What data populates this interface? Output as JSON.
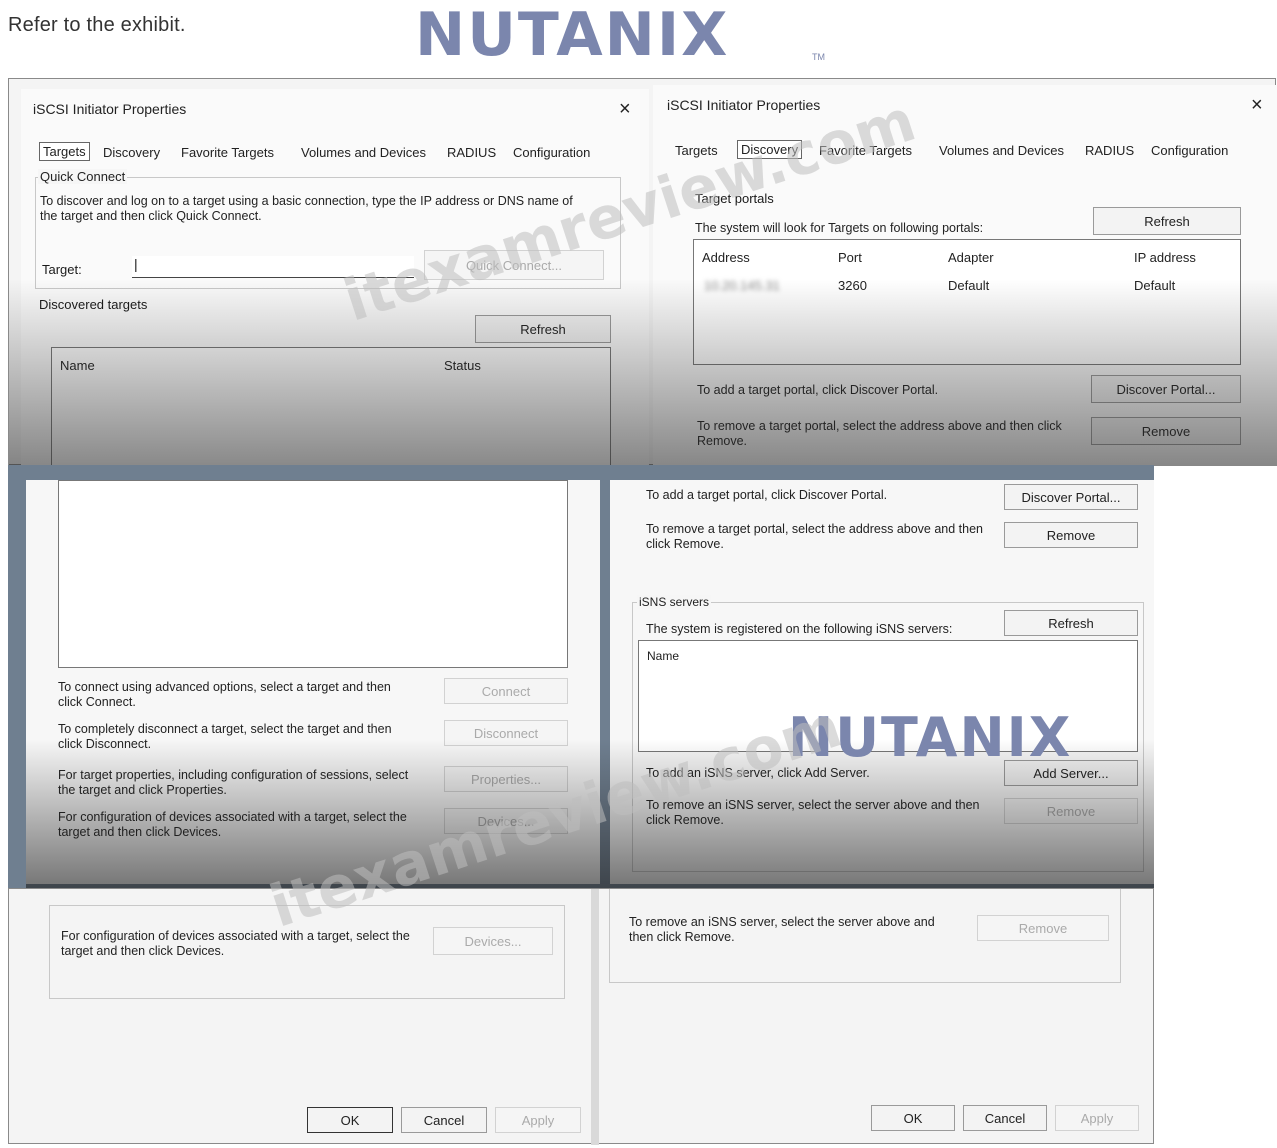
{
  "header": {
    "prompt": "Refer to the exhibit.",
    "logo_text": "NUTANIX",
    "logo_tm": "TM"
  },
  "watermark": {
    "text1": "itexamreview.com",
    "text2": "itexamreview.com"
  },
  "targets_window": {
    "title": "iSCSI Initiator Properties",
    "close_glyph": "×",
    "tabs": [
      "Targets",
      "Discovery",
      "Favorite Targets",
      "Volumes and Devices",
      "RADIUS",
      "Configuration"
    ],
    "quick_connect": {
      "label": "Quick Connect",
      "description": "To discover and log on to a target using a basic connection, type the IP address or DNS name of the target and then click Quick Connect.",
      "target_label": "Target:",
      "target_value": "|",
      "quick_connect_button": "Quick Connect..."
    },
    "discovered": {
      "label": "Discovered targets",
      "refresh_button": "Refresh",
      "columns": [
        "Name",
        "Status"
      ]
    },
    "actions": [
      {
        "text": "To connect using advanced options, select a target and then click Connect.",
        "button": "Connect"
      },
      {
        "text": "To completely disconnect a target, select the target and then click Disconnect.",
        "button": "Disconnect"
      },
      {
        "text": "For target properties, including configuration of sessions, select the target and click Properties.",
        "button": "Properties..."
      },
      {
        "text": "For configuration of devices associated with a target, select the target and then click Devices.",
        "button": "Devices..."
      }
    ],
    "bottom_devices_text": "For configuration of devices associated with a target, select the target and then click Devices.",
    "bottom_devices_button": "Devices...",
    "ok": "OK",
    "cancel": "Cancel",
    "apply": "Apply"
  },
  "discovery_window": {
    "title": "iSCSI Initiator Properties",
    "close_glyph": "×",
    "tabs": [
      "Targets",
      "Discovery",
      "Favorite Targets",
      "Volumes and Devices",
      "RADIUS",
      "Configuration"
    ],
    "portals": {
      "label": "Target portals",
      "description": "The system will look for Targets on following portals:",
      "refresh_button": "Refresh",
      "columns": [
        "Address",
        "Port",
        "Adapter",
        "IP address"
      ],
      "rows": [
        {
          "address": "10.20.145.31",
          "port": "3260",
          "adapter": "Default",
          "ip": "Default"
        }
      ],
      "add_text": "To add a target portal, click Discover Portal.",
      "add_button": "Discover Portal...",
      "remove_text": "To remove a target portal, select the address above and then click Remove.",
      "remove_button": "Remove"
    },
    "isns": {
      "label": "iSNS servers",
      "description": "The system is registered on the following iSNS servers:",
      "refresh_button": "Refresh",
      "columns": [
        "Name"
      ],
      "add_text": "To add an iSNS server, click Add Server.",
      "add_button": "Add Server...",
      "remove_text": "To remove an iSNS server, select the server above and then click Remove.",
      "remove_button": "Remove"
    },
    "bottom_remove_text": "To remove an iSNS server, select the server above and then click Remove.",
    "bottom_remove_button": "Remove",
    "ok": "OK",
    "cancel": "Cancel",
    "apply": "Apply"
  },
  "colors": {
    "logo": "#7b86ad",
    "slate": "#6f7f90",
    "watermark": "#bebebe"
  }
}
